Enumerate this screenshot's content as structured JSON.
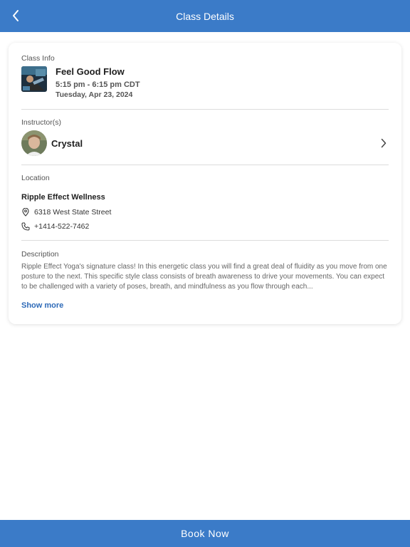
{
  "header": {
    "title": "Class Details",
    "back_icon": "chevron-left-icon"
  },
  "class_info": {
    "label": "Class Info",
    "name": "Feel Good Flow",
    "time": "5:15 pm - 6:15 pm CDT",
    "date": "Tuesday, Apr 23, 2024"
  },
  "instructors": {
    "label": "Instructor(s)",
    "items": [
      {
        "name": "Crystal"
      }
    ]
  },
  "location": {
    "label": "Location",
    "name": "Ripple Effect Wellness",
    "address": "6318 West State Street",
    "phone": "+1414-522-7462"
  },
  "description": {
    "label": "Description",
    "text": "Ripple Effect Yoga's signature class! In this energetic class you will find a great deal of fluidity as you move from one posture to the next. This specific style class consists of breath awareness to drive your movements. You can expect to be challenged with a variety of poses, breath, and mindfulness as you flow through each...",
    "show_more": "Show more"
  },
  "footer": {
    "book_label": "Book Now"
  },
  "colors": {
    "primary": "#3b7bc8",
    "link": "#2f6bb8"
  }
}
